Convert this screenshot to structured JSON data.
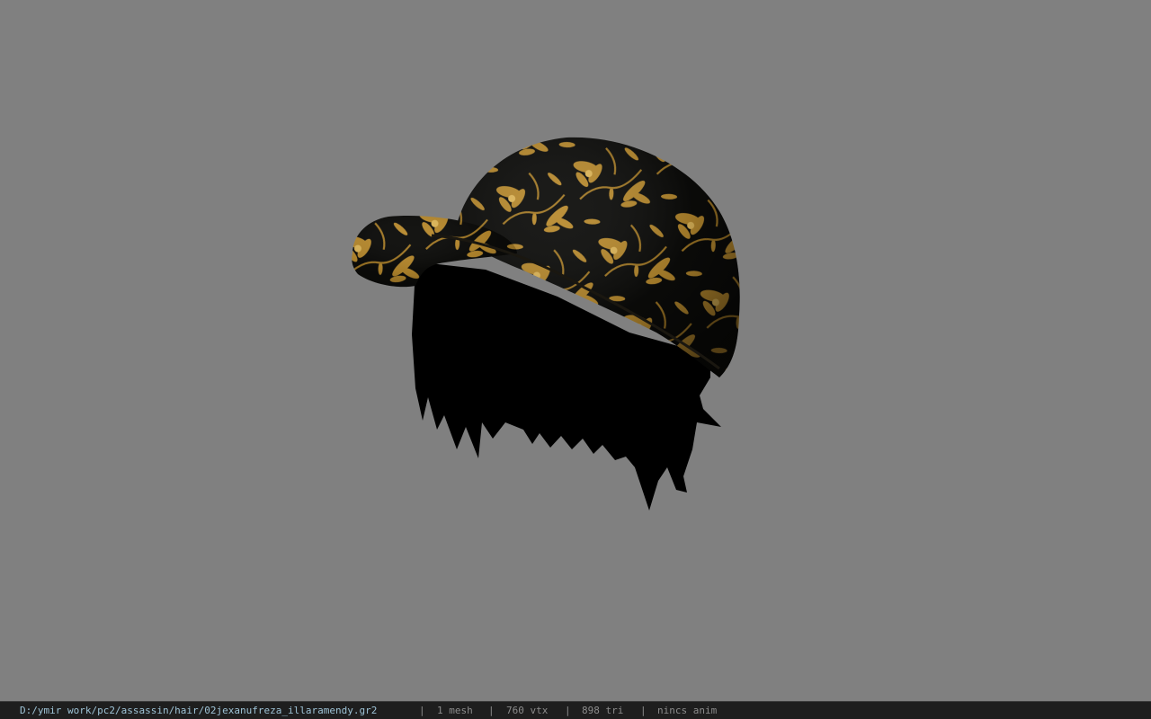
{
  "viewer": {
    "background_color": "#808080",
    "model": {
      "name": "02jexanufreza_illaramendy",
      "parts": [
        "hair",
        "cap"
      ],
      "cap_colors": {
        "base": "#0c0c0a",
        "pattern": "#b88a2e",
        "highlight": "#e0b85a"
      },
      "hair_color": "#000000"
    }
  },
  "status": {
    "file_path": "D:/ymir work/pc2/assassin/hair/02jexanufreza_illaramendy.gr2",
    "separator": "|",
    "mesh": "1 mesh",
    "vertices": "760 vtx",
    "triangles": "898 tri",
    "animation": "nincs anim"
  }
}
